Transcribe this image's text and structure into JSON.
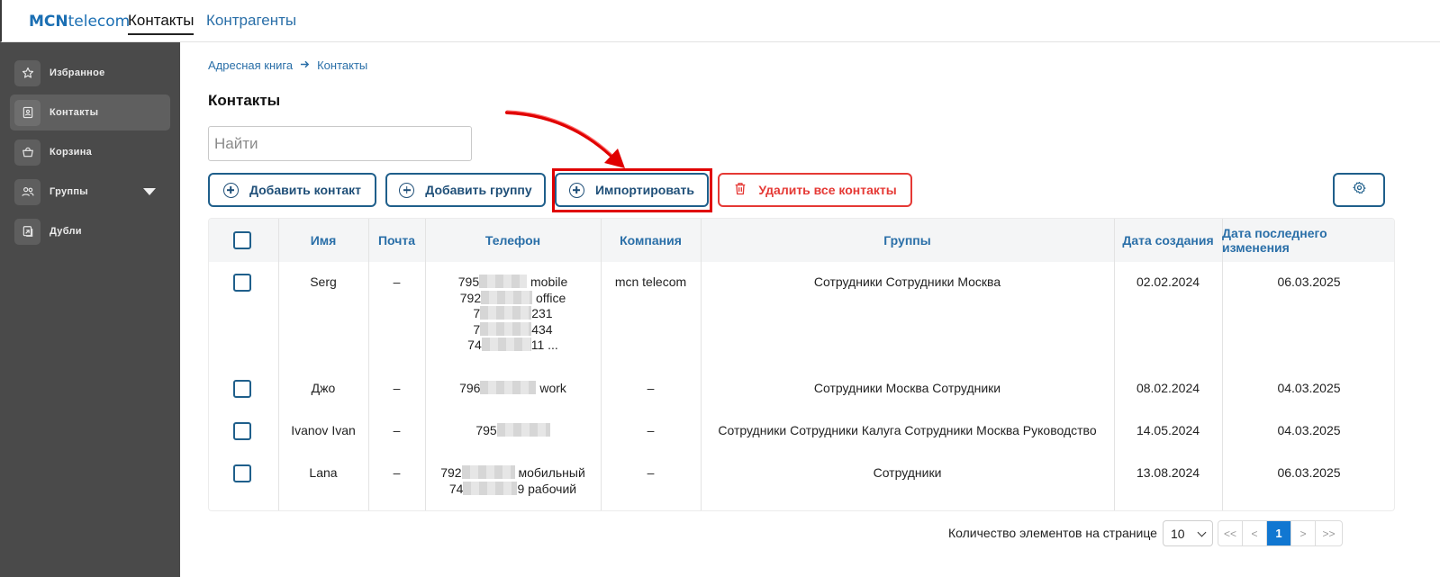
{
  "header": {
    "logo_bold": "MCN",
    "logo_rest": "telecom",
    "tabs": [
      {
        "label": "Контакты",
        "active": true
      },
      {
        "label": "Контрагенты",
        "active": false
      }
    ]
  },
  "sidebar": {
    "items": [
      {
        "label": "Избранное",
        "icon": "star-icon"
      },
      {
        "label": "Контакты",
        "icon": "contact-card-icon",
        "active": true
      },
      {
        "label": "Корзина",
        "icon": "basket-icon"
      },
      {
        "label": "Группы",
        "icon": "users-icon",
        "expandable": true
      },
      {
        "label": "Дубли",
        "icon": "duplicate-icon"
      }
    ]
  },
  "breadcrumb": {
    "root": "Адресная книга",
    "current": "Контакты"
  },
  "page": {
    "title": "Контакты",
    "search_placeholder": "Найти"
  },
  "toolbar": {
    "add_contact": "Добавить контакт",
    "add_group": "Добавить группу",
    "import": "Импортировать",
    "delete_all": "Удалить все контакты"
  },
  "table": {
    "columns": [
      "Имя",
      "Почта",
      "Телефон",
      "Компания",
      "Группы",
      "Дата создания",
      "Дата последнего изменения"
    ],
    "rows": [
      {
        "name": "Serg",
        "email": "–",
        "phones": [
          {
            "prefix": "795",
            "suffix": " mobile"
          },
          {
            "prefix": "792",
            "suffix": " office"
          },
          {
            "prefix": "7",
            "suffix": "231"
          },
          {
            "prefix": "7",
            "suffix": "434"
          },
          {
            "prefix": "74",
            "suffix": "11 ..."
          }
        ],
        "company": "mcn telecom",
        "groups": "Сотрудники Сотрудники Москва",
        "created": "02.02.2024",
        "modified": "06.03.2025"
      },
      {
        "name": "Джо",
        "email": "–",
        "phones": [
          {
            "prefix": "796",
            "suffix": " work"
          }
        ],
        "company": "–",
        "groups": "Сотрудники Москва Сотрудники",
        "created": "08.02.2024",
        "modified": "04.03.2025"
      },
      {
        "name": "Ivanov Ivan",
        "email": "–",
        "phones": [
          {
            "prefix": "795",
            "suffix": ""
          }
        ],
        "company": "–",
        "groups": "Сотрудники Сотрудники Калуга Сотрудники Москва Руководство",
        "created": "14.05.2024",
        "modified": "04.03.2025"
      },
      {
        "name": "Lana",
        "email": "–",
        "phones": [
          {
            "prefix": "792",
            "suffix": " мобильный"
          },
          {
            "prefix": "74",
            "suffix": "9 рабочий"
          }
        ],
        "company": "–",
        "groups": "Сотрудники",
        "created": "13.08.2024",
        "modified": "06.03.2025"
      }
    ]
  },
  "pagination": {
    "page_size_label": "Количество элементов на странице",
    "page_size": "10",
    "first": "<<",
    "prev": "<",
    "current": "1",
    "next": ">",
    "last": ">>"
  },
  "colors": {
    "accent": "#1f5f8b",
    "link": "#2a6fa8",
    "danger": "#e53935",
    "sidebar": "#4a4a4a",
    "highlight": "#e00000",
    "page_active": "#1177d1"
  }
}
